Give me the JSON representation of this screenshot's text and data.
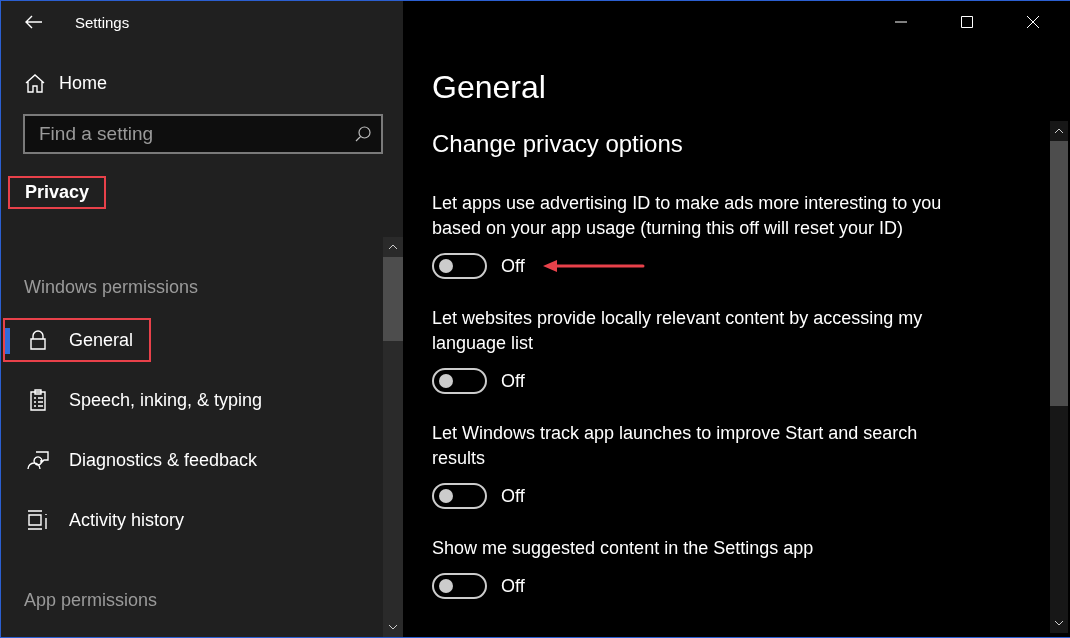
{
  "window": {
    "title": "Settings"
  },
  "sidebar": {
    "home": "Home",
    "search": {
      "placeholder": "Find a setting"
    },
    "category": {
      "label": "Privacy",
      "annotated": true
    },
    "sections": [
      {
        "heading": "Windows permissions",
        "items": [
          {
            "label": "General",
            "selected": true,
            "annotated": true
          },
          {
            "label": "Speech, inking, & typing",
            "selected": false,
            "annotated": false
          },
          {
            "label": "Diagnostics & feedback",
            "selected": false,
            "annotated": false
          },
          {
            "label": "Activity history",
            "selected": false,
            "annotated": false
          }
        ]
      },
      {
        "heading": "App permissions"
      }
    ]
  },
  "main": {
    "title": "General",
    "subtitle": "Change privacy options",
    "settings": [
      {
        "description": "Let apps use advertising ID to make ads more interesting to you based on your app usage (turning this off will reset your ID)",
        "on": false,
        "state_label": "Off",
        "arrow": true
      },
      {
        "description": "Let websites provide locally relevant content by accessing my language list",
        "on": false,
        "state_label": "Off",
        "arrow": false
      },
      {
        "description": "Let Windows track app launches to improve Start and search results",
        "on": false,
        "state_label": "Off",
        "arrow": false
      },
      {
        "description": "Show me suggested content in the Settings app",
        "on": false,
        "state_label": "Off",
        "arrow": false
      }
    ]
  }
}
